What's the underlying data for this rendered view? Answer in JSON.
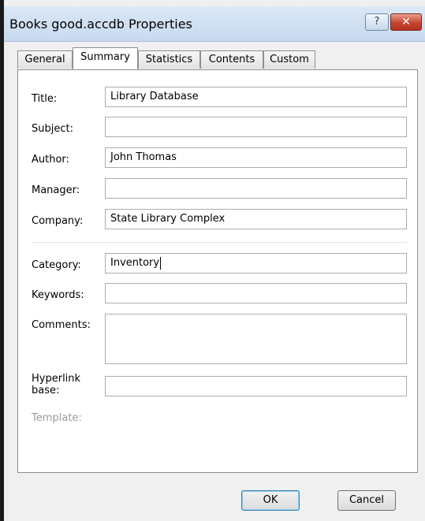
{
  "window": {
    "title": "Books good.accdb Properties",
    "help_label": "?",
    "close_label": "✕"
  },
  "tabs": [
    {
      "label": "General",
      "active": false
    },
    {
      "label": "Summary",
      "active": true
    },
    {
      "label": "Statistics",
      "active": false
    },
    {
      "label": "Contents",
      "active": false
    },
    {
      "label": "Custom",
      "active": false
    }
  ],
  "fields": {
    "title": {
      "label": "Title:",
      "value": "Library Database"
    },
    "subject": {
      "label": "Subject:",
      "value": ""
    },
    "author": {
      "label": "Author:",
      "value": "John Thomas"
    },
    "manager": {
      "label": "Manager:",
      "value": ""
    },
    "company": {
      "label": "Company:",
      "value": "State Library Complex"
    },
    "category": {
      "label": "Category:",
      "value": "Inventory"
    },
    "keywords": {
      "label": "Keywords:",
      "value": ""
    },
    "comments": {
      "label": "Comments:",
      "value": ""
    },
    "hyperlink_base": {
      "label_line1": "Hyperlink",
      "label_line2": "base:",
      "value": ""
    },
    "template": {
      "label": "Template:"
    }
  },
  "buttons": {
    "ok": "OK",
    "cancel": "Cancel"
  }
}
